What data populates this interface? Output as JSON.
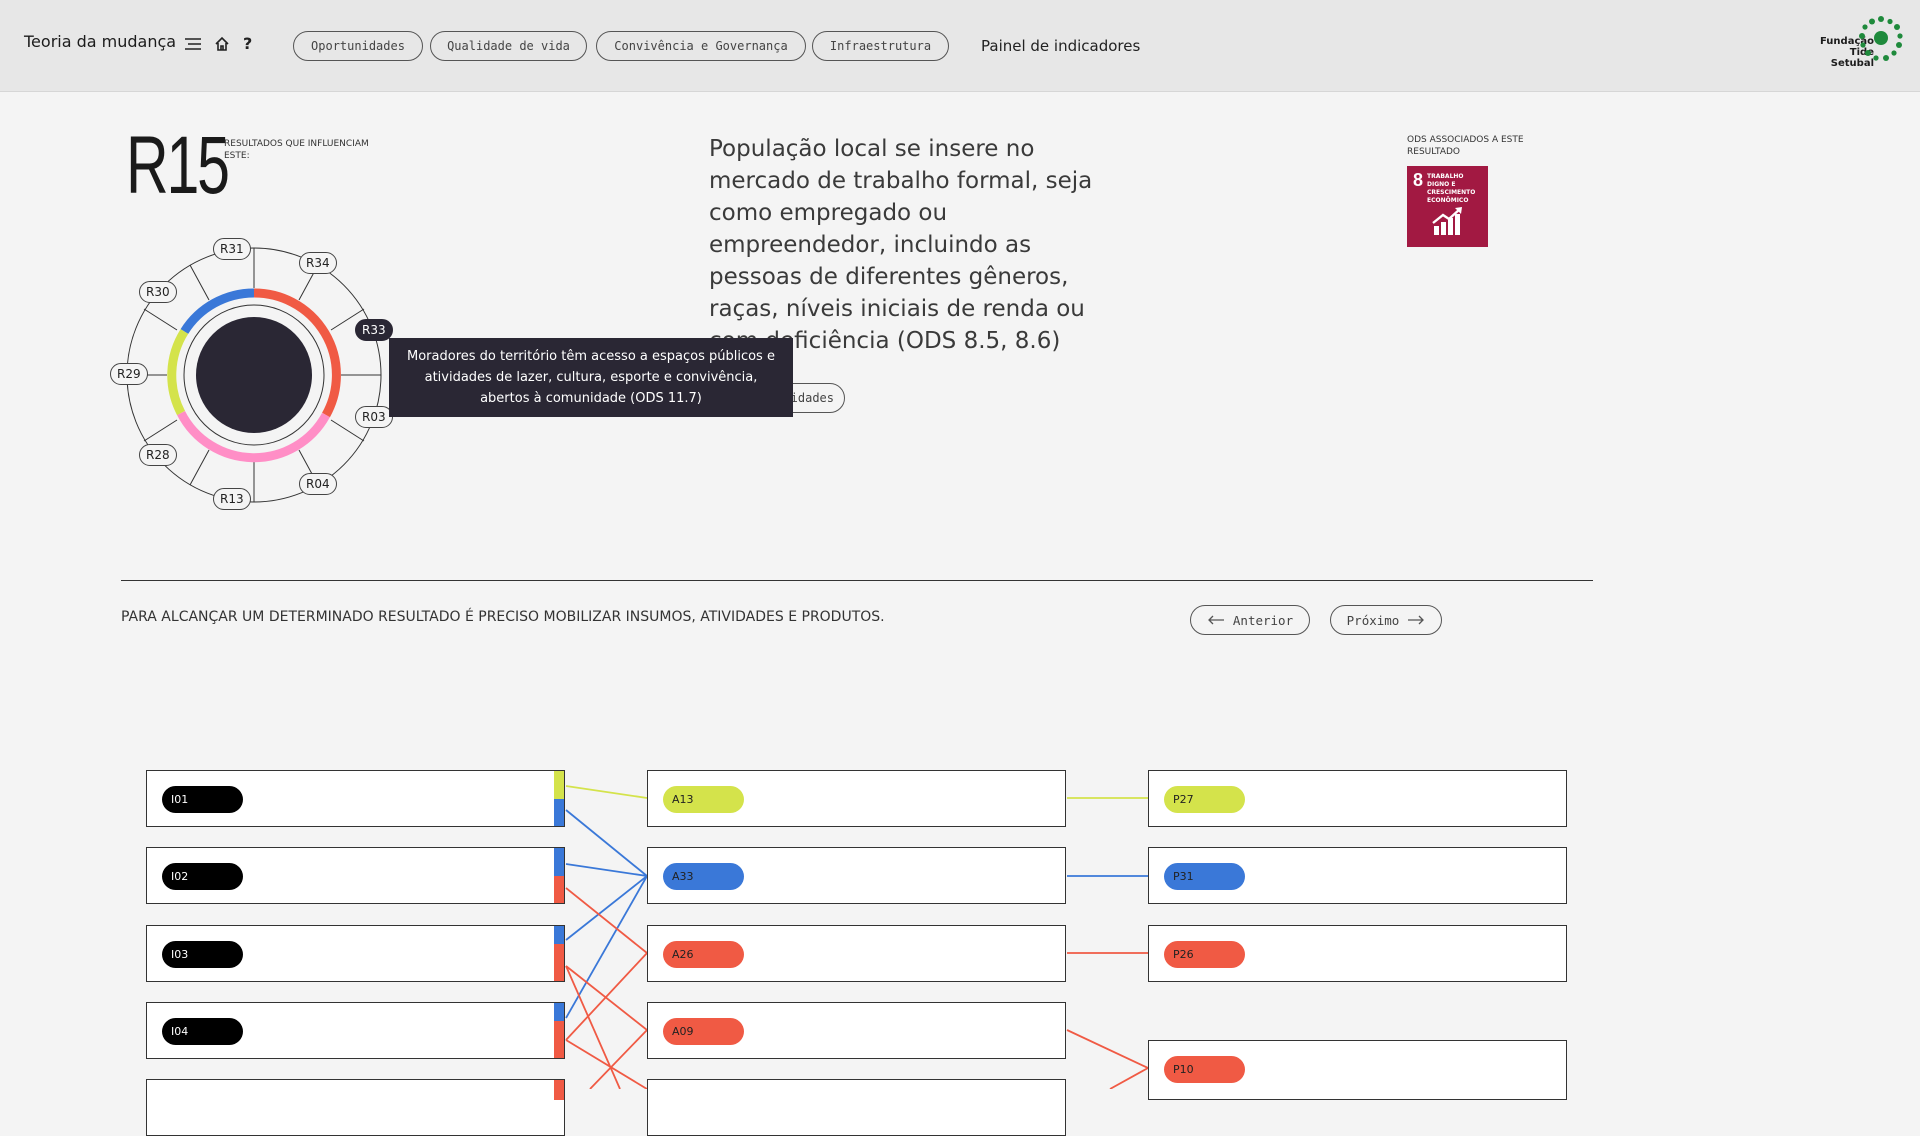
{
  "header": {
    "brand": "Teoria da mudança",
    "help": "?",
    "nav": [
      "Oportunidades",
      "Qualidade de vida",
      "Convivência e Governança",
      "Infraestrutura"
    ],
    "panel_link": "Painel de indicadores",
    "logo": [
      "Fundação",
      "Tide",
      "Setubal"
    ]
  },
  "result": {
    "code": "R15",
    "influence_label": "RESULTADOS QUE INFLUENCIAM ESTE:",
    "description": "População local se insere no mercado de trabalho formal, seja como empregado ou empreendedor, incluindo as pessoas de diferentes gêneros, raças, níveis iniciais de renda ou com deficiência (ODS 8.5, 8.6)",
    "ods_label": "ODS ASSOCIADOS A ESTE RESULTADO",
    "ods_number": "8",
    "ods_title": "TRABALHO DIGNO E CRESCIMENTO ECONÔMICO",
    "theme_pill": "Oportunidades",
    "theme_pill_visible": "idades"
  },
  "wheel": {
    "nodes": [
      "R31",
      "R34",
      "R33",
      "R03",
      "R04",
      "R13",
      "R28",
      "R29",
      "R30"
    ],
    "active_node": "R33",
    "tooltip": "Moradores do território têm acesso a espaços públicos e atividades de lazer, cultura, esporte e convivência, abertos à comunidade (ODS 11.7)",
    "colors": {
      "blue": "#3a78d8",
      "red": "#f05a44",
      "pink": "#ff8ec6",
      "lime": "#d4e34b",
      "center": "#2a2734"
    }
  },
  "section": {
    "text": "PARA ALCANÇAR UM DETERMINADO RESULTADO É PRECISO MOBILIZAR INSUMOS, ATIVIDADES E PRODUTOS.",
    "prev": "Anterior",
    "next": "Próximo"
  },
  "flow": {
    "inputs": [
      "I01",
      "I02",
      "I03",
      "I04"
    ],
    "activities": [
      "A13",
      "A33",
      "A26",
      "A09"
    ],
    "products": [
      "P27",
      "P31",
      "P26",
      "P10"
    ]
  }
}
